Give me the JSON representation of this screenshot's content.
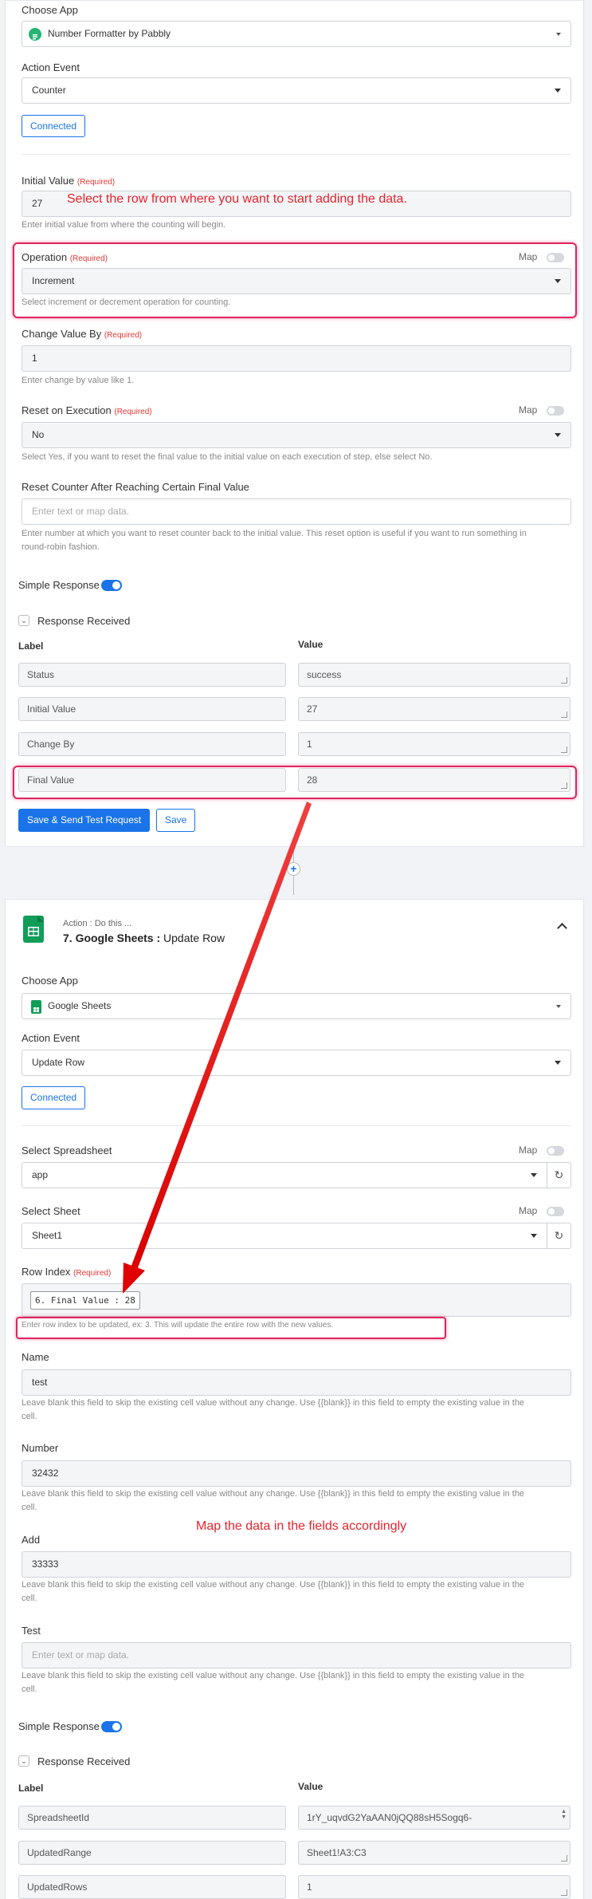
{
  "step1": {
    "choose_app_label": "Choose App",
    "app_name": "Number Formatter by Pabbly",
    "action_event_label": "Action Event",
    "action_event_value": "Counter",
    "connected_label": "Connected",
    "initial_value_label": "Initial Value",
    "required": "(Required)",
    "initial_value": "27",
    "initial_value_help": "Enter initial value from where the counting will begin.",
    "operation_label": "Operation",
    "map_label": "Map",
    "operation_value": "Increment",
    "operation_help": "Select increment or decrement operation for counting.",
    "change_value_label": "Change Value By",
    "change_value": "1",
    "change_value_help": "Enter change by value like 1.",
    "reset_exec_label": "Reset on Execution",
    "reset_exec_value": "No",
    "reset_exec_help": "Select Yes, if you want to reset the final value to the initial value on each execution of step, else select No.",
    "reset_final_label": "Reset Counter After Reaching Certain Final Value",
    "reset_final_placeholder": "Enter text or map data.",
    "reset_final_help_1": "Enter number at which you want to reset counter back to the initial value. This reset option is useful if you want to run something in",
    "reset_final_help_2": "round-robin fashion.",
    "simple_response_label": "Simple Response",
    "response_received_label": "Response Received",
    "label_header": "Label",
    "value_header": "Value",
    "responses": [
      {
        "label": "Status",
        "value": "success"
      },
      {
        "label": "Initial Value",
        "value": "27"
      },
      {
        "label": "Change By",
        "value": "1"
      },
      {
        "label": "Final Value",
        "value": "28"
      }
    ],
    "save_send_label": "Save & Send Test Request",
    "save_label": "Save"
  },
  "annotations": {
    "row_note": "Select the row from where you want to start adding the data.",
    "map_note": "Map the data in the fields accordingly"
  },
  "connector": {
    "plus": "+"
  },
  "step2": {
    "action_caption": "Action : Do this ...",
    "step_title": "7. Google Sheets : ",
    "step_title_action": "Update Row",
    "choose_app_label": "Choose App",
    "app_name": "Google Sheets",
    "action_event_label": "Action Event",
    "action_event_value": "Update Row",
    "connected_label": "Connected",
    "select_spreadsheet_label": "Select Spreadsheet",
    "map_label": "Map",
    "spreadsheet_value": "app",
    "select_sheet_label": "Select Sheet",
    "sheet_value": "Sheet1",
    "row_index_label": "Row Index",
    "required": "(Required)",
    "row_index_token": "6. Final Value : 28",
    "row_index_help": "Enter row index to be updated, ex: 3. This will update the entire row with the new values.",
    "fields": [
      {
        "label": "Name",
        "value": "test",
        "placeholder": ""
      },
      {
        "label": "Number",
        "value": "32432",
        "placeholder": ""
      },
      {
        "label": "Add",
        "value": "33333",
        "placeholder": ""
      },
      {
        "label": "Test",
        "value": "",
        "placeholder": "Enter text or map data."
      }
    ],
    "field_help_1": "Leave blank this field to skip the existing cell value without any change. Use {{blank}} in this field to empty the existing value in the",
    "field_help_2": "cell.",
    "simple_response_label": "Simple Response",
    "response_received_label": "Response Received",
    "label_header": "Label",
    "value_header": "Value",
    "responses": [
      {
        "label": "SpreadsheetId",
        "value": "1rY_uqvdG2YaAAN0jQQ88sH5Sogq6-"
      },
      {
        "label": "UpdatedRange",
        "value": "Sheet1!A3:C3"
      },
      {
        "label": "UpdatedRows",
        "value": "1"
      }
    ]
  },
  "colors": {
    "accent": "#1a73e8",
    "annotation": "#e8232d",
    "highlight": "#e0245e",
    "sheets_green": "#0f9d58",
    "pabbly_green": "#22b573"
  }
}
